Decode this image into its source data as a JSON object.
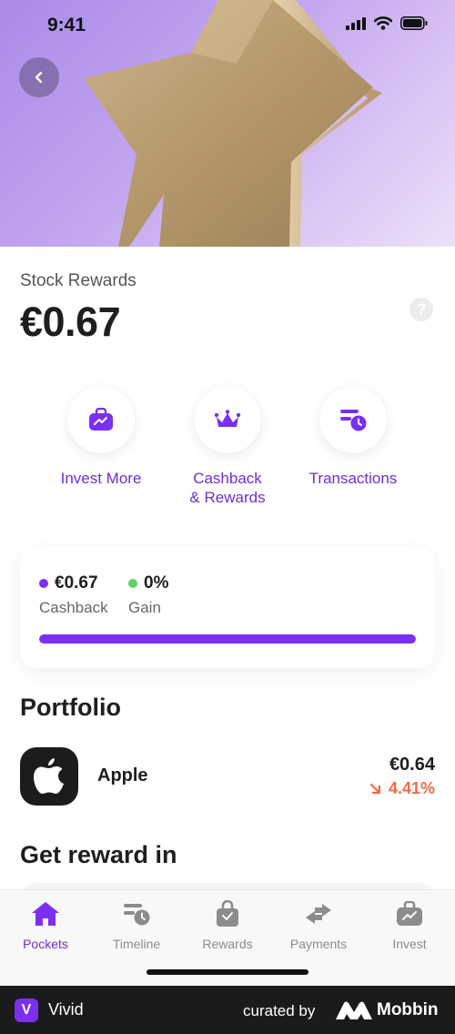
{
  "status_bar": {
    "time": "9:41"
  },
  "hero": {
    "image": "gold-star-image",
    "back_icon": "chevron-left-icon"
  },
  "rewards": {
    "title": "Stock Rewards",
    "balance": "€0.67",
    "help_icon": "question-mark-icon",
    "help_symbol": "?"
  },
  "actions": [
    {
      "label": "Invest More",
      "icon": "briefcase-icon"
    },
    {
      "label": "Cashback & Rewards",
      "label_line1": "Cashback",
      "label_line2": "& Rewards",
      "icon": "crown-icon"
    },
    {
      "label": "Transactions",
      "icon": "transactions-clock-icon"
    }
  ],
  "cashback_card": {
    "cashback": {
      "value": "€0.67",
      "caption": "Cashback",
      "dot_color": "#7b2ff0"
    },
    "gain": {
      "value": "0%",
      "caption": "Gain",
      "dot_color": "#5ed364"
    },
    "progress_fraction": 1.0
  },
  "portfolio": {
    "title": "Portfolio",
    "holdings": [
      {
        "name": "Apple",
        "logo": "apple-logo-icon",
        "price": "€0.64",
        "change": "4.41%",
        "direction": "down",
        "change_color": "#f06a45"
      }
    ]
  },
  "get_reward": {
    "title": "Get reward in"
  },
  "tab_bar": {
    "items": [
      {
        "label": "Pockets",
        "icon": "home-icon",
        "active": true
      },
      {
        "label": "Timeline",
        "icon": "timeline-icon",
        "active": false
      },
      {
        "label": "Rewards",
        "icon": "gift-bag-icon",
        "active": false
      },
      {
        "label": "Payments",
        "icon": "transfer-arrows-icon",
        "active": false
      },
      {
        "label": "Invest",
        "icon": "invest-briefcase-icon",
        "active": false
      }
    ]
  },
  "footer": {
    "app_initial": "V",
    "app_name": "Vivid",
    "curated_by": "curated by",
    "brand": "Mobbin"
  },
  "colors": {
    "accent": "#6d2fd8",
    "progress": "#7b2ff0",
    "negative": "#f06a45",
    "positive": "#5ed364"
  }
}
